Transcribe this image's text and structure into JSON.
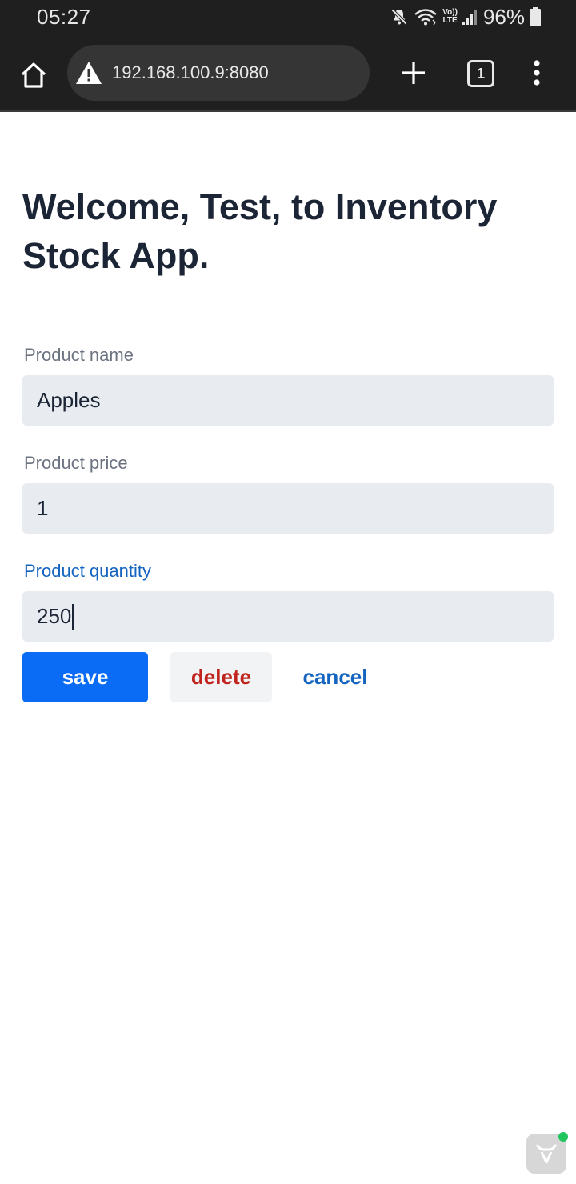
{
  "status_bar": {
    "time": "05:27",
    "battery": "96%",
    "volte_top": "Vo))",
    "volte_bottom": "LTE",
    "icons": [
      "mute-icon",
      "wifi-icon",
      "volte-icon",
      "signal-icon",
      "battery-icon"
    ]
  },
  "browser": {
    "url": "192.168.100.9:8080",
    "tab_count": "1",
    "icons": [
      "home-icon",
      "warning-icon",
      "plus-icon",
      "tabs-icon",
      "more-menu-icon"
    ]
  },
  "page": {
    "title": "Welcome, Test, to Inventory Stock App.",
    "fields": [
      {
        "label": "Product name",
        "value": "Apples"
      },
      {
        "label": "Product price",
        "value": "1"
      },
      {
        "label": "Product quantity",
        "value": "250"
      }
    ],
    "buttons": {
      "save": "save",
      "delete": "delete",
      "cancel": "cancel"
    }
  },
  "colors": {
    "title": "#1b2535",
    "label": "#6b7280",
    "active_label": "#1565c0",
    "input_bg": "#e8ebf0",
    "save_bg": "#0a6cf5",
    "delete_text": "#c0241c",
    "cancel_text": "#1565c0",
    "status_bg": "#1f1f1f",
    "badge_dot": "#22c55e"
  }
}
